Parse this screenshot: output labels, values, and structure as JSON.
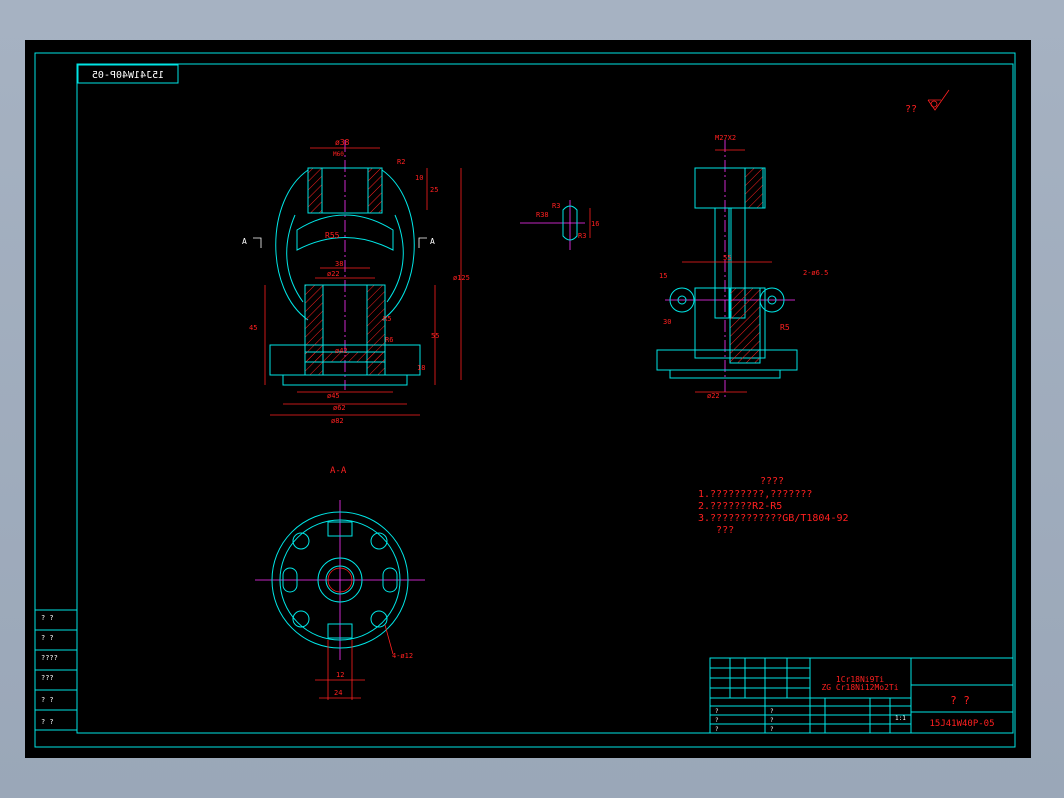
{
  "title_block": {
    "drawing_number": "15J41W40P-05",
    "drawing_number_mirrored": "15J41W40P-05",
    "material_line1": "1Cr18Ni9Ti",
    "material_line2": "ZG Cr18Ni12Mo2Ti",
    "part_name": "? ?",
    "scale": "1:1",
    "small_cells": [
      "?",
      "?",
      "?",
      "?",
      "?",
      "?"
    ]
  },
  "roughness_note": "??",
  "section_label": "A-A",
  "section_marks": [
    "A",
    "A"
  ],
  "technical_requirements": {
    "heading": "????",
    "lines": [
      "1.?????????,???????",
      "2.???????R2-R5",
      "3.????????????GB/T1804-92",
      "   ???"
    ]
  },
  "left_margin_labels": [
    "? ?",
    "? ?",
    "????",
    "???",
    "? ?",
    "? ?"
  ],
  "dimensions": {
    "front": [
      "ø38",
      "M60",
      "1.5x45°",
      "R2",
      "R2",
      "10",
      "25",
      "1.5x45°",
      "ø22",
      "R55",
      "38",
      "ø22",
      "ø125",
      "45",
      "55",
      "R5",
      "ø42",
      "R6",
      "ø82",
      "ø62",
      "ø45",
      "18",
      "1.5x45°",
      "R3"
    ],
    "detail": [
      "R3",
      "R38",
      "16",
      "R3"
    ],
    "side": [
      "M27X2",
      "55",
      "2-ø6.5",
      "R5",
      "30",
      "ø22",
      "15"
    ],
    "section": [
      "12",
      "24",
      "4-ø12"
    ]
  }
}
